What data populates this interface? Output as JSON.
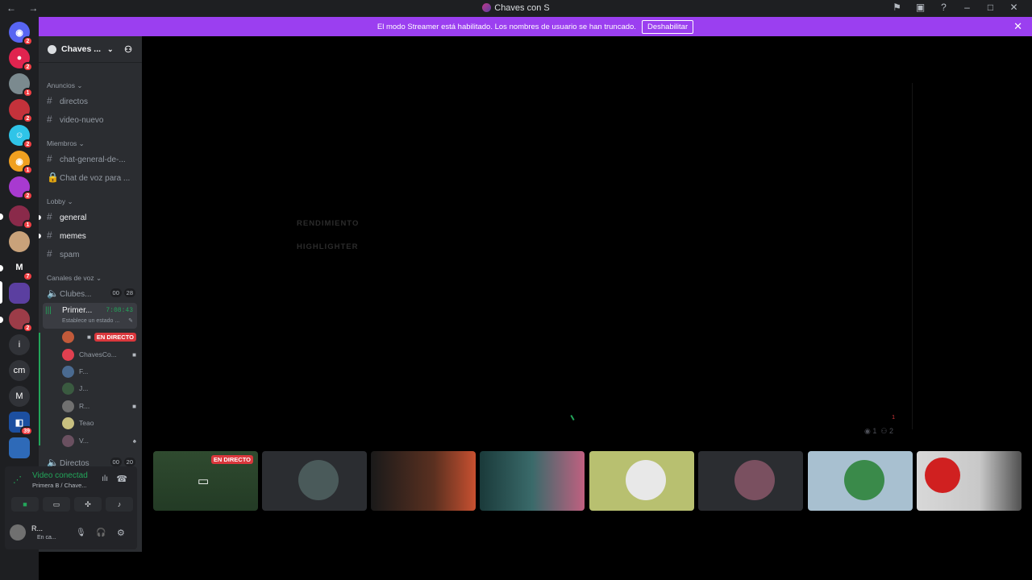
{
  "window": {
    "title": "Chaves con S",
    "nav_back": "←",
    "nav_forward": "→"
  },
  "banner": {
    "text": "El modo Streamer está habilitado. Los nombres de usuario se han truncado.",
    "button": "Deshabilitar"
  },
  "guild_badges": [
    "2",
    "2",
    "1",
    "2",
    "2",
    "1",
    "2",
    "1",
    "7",
    "2",
    "39"
  ],
  "guild_letters": {
    "i": "i",
    "cm": "cm",
    "m": "M"
  },
  "server": {
    "name": "Chaves ..."
  },
  "categories": {
    "anuncios": "Anuncios",
    "miembros": "Miembros",
    "lobby": "Lobby",
    "voz": "Canales de voz"
  },
  "channels": {
    "directos": "directos",
    "video_nuevo": "video-nuevo",
    "chat_general": "chat-general-de-...",
    "chat_voz": "Chat de voz para ...",
    "general": "general",
    "memes": "memes",
    "spam": "spam",
    "clubes": "Clubes...",
    "clubes_count_a": "00",
    "clubes_count_b": "28",
    "primera": "Primer...",
    "primera_time": "7:08:43",
    "primera_status": "Establece un estado ...",
    "directos2": "Directos",
    "directos2_count_a": "00",
    "directos2_count_b": "20"
  },
  "members": [
    {
      "name": "",
      "live": "EN DIRECTO"
    },
    {
      "name": "ChavesCo..."
    },
    {
      "name": "F..."
    },
    {
      "name": "J..."
    },
    {
      "name": "R..."
    },
    {
      "name": "Teao"
    },
    {
      "name": "V..."
    }
  ],
  "voice_panel": {
    "status": "Video conectad",
    "location": "Primera B / Chave...",
    "user": "R...",
    "user_status": "En ca..."
  },
  "stage": {
    "ghost1": "RENDIMIENTO",
    "ghost2": "HIGHLIGHTER",
    "viewers": "1",
    "participants": "2",
    "notif": "1"
  },
  "tiles": {
    "live_label": "EN DIRECTO"
  }
}
